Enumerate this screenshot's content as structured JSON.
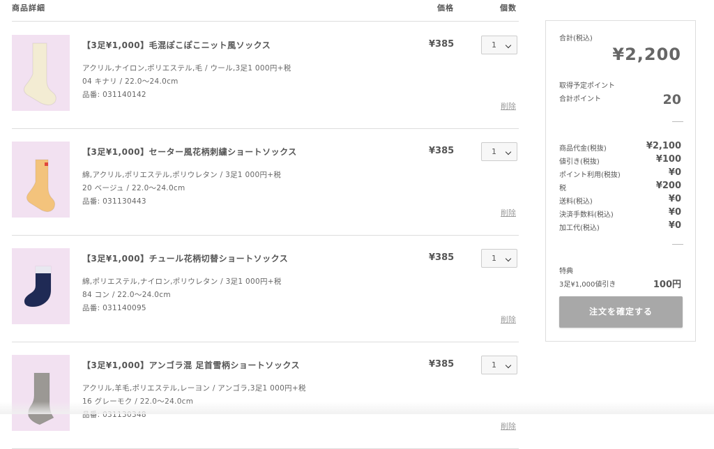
{
  "header": {
    "detail": "商品詳細",
    "price": "価格",
    "qty": "個数"
  },
  "items": [
    {
      "name": "【3足¥1,000】毛混ぽこぽこニット風ソックス",
      "material": "アクリル,ナイロン,ポリエステル,毛 / ウール,3足1 000円+税",
      "variant": "04 キナリ / 22.0〜24.0cm",
      "sku": "品番: 031140142",
      "price": "¥385",
      "qty": "1",
      "delete": "削除",
      "sock_color": "#f3ecd3"
    },
    {
      "name": "【3足¥1,000】セーター風花柄刺繍ショートソックス",
      "material": "綿,アクリル,ポリエステル,ポリウレタン / 3足1 000円+税",
      "variant": "20 ベージュ / 22.0〜24.0cm",
      "sku": "品番: 031130443",
      "price": "¥385",
      "qty": "1",
      "delete": "削除",
      "sock_color": "#f3c37c"
    },
    {
      "name": "【3足¥1,000】チュール花柄切替ショートソックス",
      "material": "綿,ポリエステル,ナイロン,ポリウレタン / 3足1 000円+税",
      "variant": "84 コン / 22.0〜24.0cm",
      "sku": "品番: 031140095",
      "price": "¥385",
      "qty": "1",
      "delete": "削除",
      "sock_color": "#1f2a55"
    },
    {
      "name": "【3足¥1,000】アンゴラ混 足首雪柄ショートソックス",
      "material": "アクリル,羊毛,ポリエステル,レーヨン / アンゴラ,3足1 000円+税",
      "variant": "16 グレーモク / 22.0〜24.0cm",
      "sku": "品番: 031130348",
      "price": "¥385",
      "qty": "1",
      "delete": "削除",
      "sock_color": "#9b9894"
    }
  ],
  "summary": {
    "total_label": "合計(税込)",
    "total": "¥2,200",
    "points_expected_label": "取得予定ポイント",
    "points_total_label": "合計ポイント",
    "points_total": "20",
    "rows": [
      {
        "label": "商品代金(税抜)",
        "value": "¥2,100"
      },
      {
        "label": "値引き(税抜)",
        "value": "¥100"
      },
      {
        "label": "ポイント利用(税抜)",
        "value": "¥0"
      },
      {
        "label": "税",
        "value": "¥200"
      },
      {
        "label": "送料(税込)",
        "value": "¥0"
      },
      {
        "label": "決済手数料(税込)",
        "value": "¥0"
      },
      {
        "label": "加工代(税込)",
        "value": "¥0"
      }
    ],
    "perk_label": "特典",
    "perk_name": "3足¥1,000値引き",
    "perk_value": "100円",
    "confirm_label": "注文を確定する"
  }
}
